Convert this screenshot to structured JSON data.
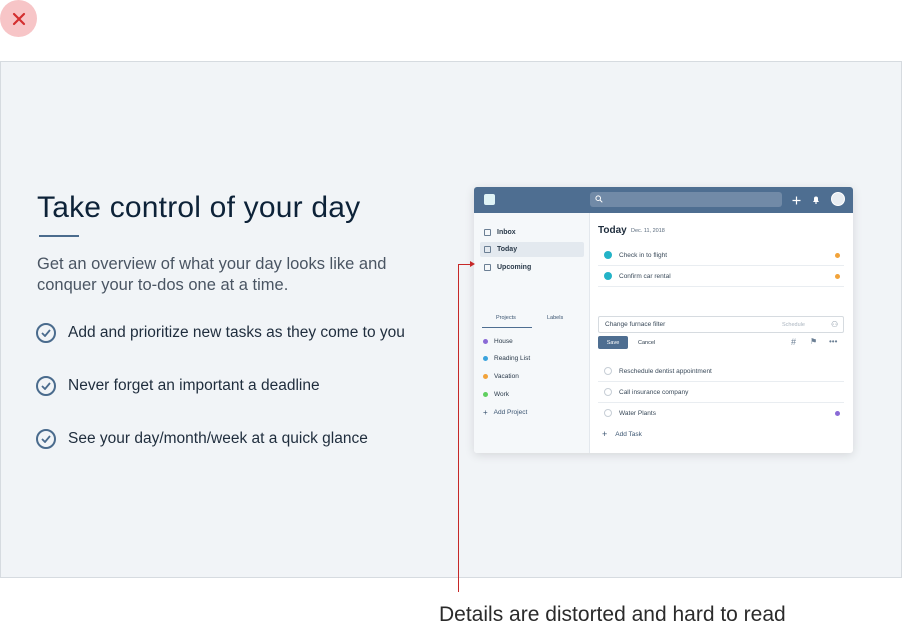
{
  "close": {
    "icon": "close-icon"
  },
  "hero": {
    "title": "Take control of your day",
    "subtitle": "Get an overview of what your day looks like and conquer your to-dos one at a time.",
    "features": [
      "Add and prioritize new tasks as they come to you",
      "Never forget an important a deadline",
      "See your day/month/week at a quick glance"
    ]
  },
  "app": {
    "sidebar": {
      "items": [
        "Inbox",
        "Today",
        "Upcoming"
      ],
      "tabs": [
        "Projects",
        "Labels"
      ],
      "projects": [
        {
          "name": "House",
          "color": "#8a6ad6"
        },
        {
          "name": "Reading List",
          "color": "#3aa3dd"
        },
        {
          "name": "Vacation",
          "color": "#f2a33a"
        },
        {
          "name": "Work",
          "color": "#5fcf5f"
        }
      ],
      "add_project": "Add Project"
    },
    "main": {
      "title": "Today",
      "date": "Dec. 11, 2018",
      "tasks_done": [
        {
          "label": "Check in to flight",
          "color": "#f2a33a"
        },
        {
          "label": "Confirm car rental",
          "color": "#f2a33a"
        }
      ],
      "editor": {
        "text": "Change furnace filter",
        "schedule": "Schedule"
      },
      "save": "Save",
      "cancel": "Cancel",
      "tasks_open": [
        {
          "label": "Reschedule dentist appointment",
          "color": ""
        },
        {
          "label": "Call insurance company",
          "color": ""
        },
        {
          "label": "Water Plants",
          "color": "#8a6ad6"
        }
      ],
      "add_task": "Add Task"
    }
  },
  "annotation": {
    "text": "Details are distorted and hard to read",
    "color": "#c62828"
  }
}
